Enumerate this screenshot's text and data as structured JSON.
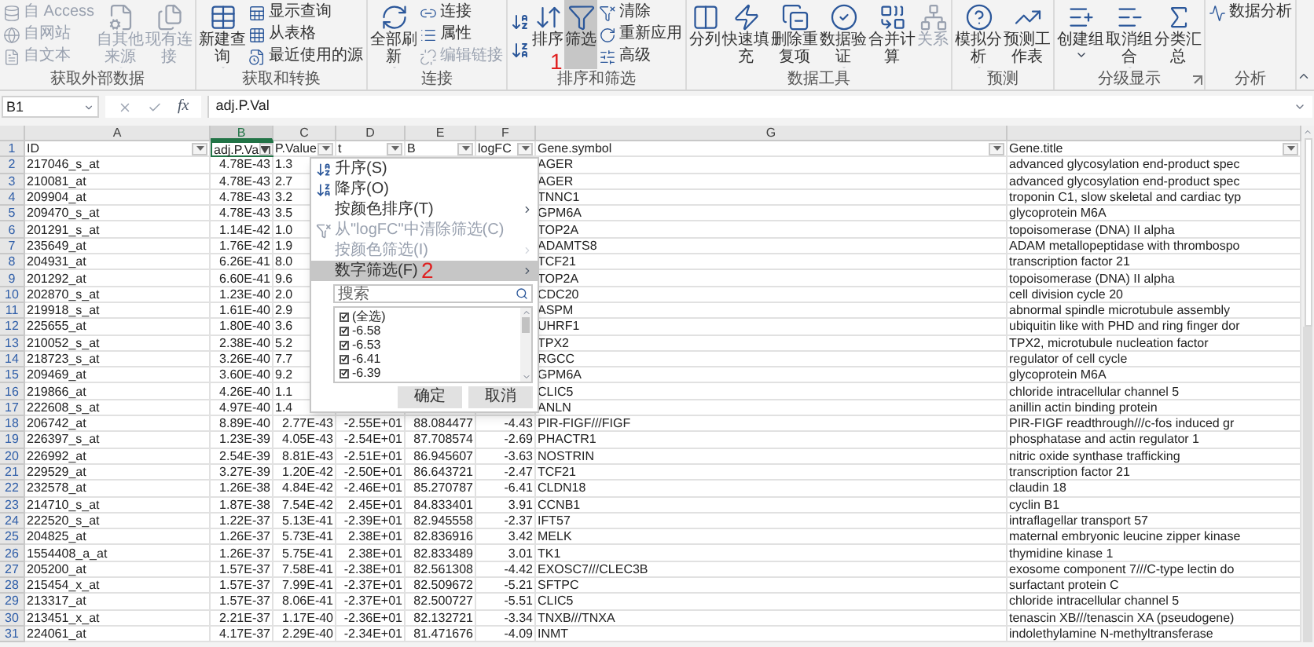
{
  "ribbon": {
    "groups": [
      {
        "label": "获取外部数据",
        "items": [
          {
            "kind": "stack",
            "buttons": [
              {
                "label": "自 Access",
                "disabled": true
              },
              {
                "label": "自网站",
                "disabled": true
              },
              {
                "label": "自文本",
                "disabled": true
              }
            ]
          },
          {
            "kind": "large",
            "label": "自其他来源",
            "disabled": true,
            "dropdown": true
          },
          {
            "kind": "large",
            "label": "现有连接",
            "disabled": true,
            "dropdown": false
          }
        ]
      },
      {
        "label": "获取和转换",
        "items": [
          {
            "kind": "large",
            "label": "新建查询",
            "disabled": false,
            "dropdown": true
          },
          {
            "kind": "stack",
            "buttons": [
              {
                "label": "显示查询",
                "disabled": false
              },
              {
                "label": "从表格",
                "disabled": false
              },
              {
                "label": "最近使用的源",
                "disabled": false
              }
            ]
          }
        ]
      },
      {
        "label": "连接",
        "items": [
          {
            "kind": "large",
            "label": "全部刷新",
            "disabled": false,
            "dropdown": true
          },
          {
            "kind": "stack",
            "buttons": [
              {
                "label": "连接",
                "disabled": false
              },
              {
                "label": "属性",
                "disabled": false
              },
              {
                "label": "编辑链接",
                "disabled": true
              }
            ]
          }
        ]
      },
      {
        "label": "排序和筛选",
        "items": [
          {
            "kind": "iconstack"
          },
          {
            "kind": "large",
            "label": "排序",
            "disabled": false,
            "dropdown": false,
            "pressed": false,
            "badge": "1"
          },
          {
            "kind": "large",
            "label": "筛选",
            "disabled": false,
            "dropdown": false,
            "pressed": true
          },
          {
            "kind": "stack",
            "buttons": [
              {
                "label": "清除",
                "disabled": false
              },
              {
                "label": "重新应用",
                "disabled": false
              },
              {
                "label": "高级",
                "disabled": false
              }
            ]
          }
        ]
      },
      {
        "label": "数据工具",
        "items": [
          {
            "kind": "large",
            "label": "分列",
            "disabled": false,
            "dropdown": false
          },
          {
            "kind": "large",
            "label": "快速填充",
            "disabled": false,
            "dropdown": false
          },
          {
            "kind": "large",
            "label": "删除重复项",
            "disabled": false,
            "dropdown": false
          },
          {
            "kind": "large",
            "label": "数据验证",
            "disabled": false,
            "dropdown": true
          },
          {
            "kind": "large",
            "label": "合并计算",
            "disabled": false,
            "dropdown": false
          },
          {
            "kind": "large",
            "label": "关系",
            "disabled": true,
            "dropdown": false
          }
        ]
      },
      {
        "label": "预测",
        "items": [
          {
            "kind": "large",
            "label": "模拟分析",
            "disabled": false,
            "dropdown": true
          },
          {
            "kind": "large",
            "label": "预测工作表",
            "disabled": false,
            "dropdown": false
          }
        ]
      },
      {
        "label": "分级显示",
        "dialog_launcher": true,
        "items": [
          {
            "kind": "large",
            "label": "创建组",
            "disabled": false,
            "dropdown": true
          },
          {
            "kind": "large",
            "label": "取消组合",
            "disabled": false,
            "dropdown": true
          },
          {
            "kind": "large",
            "label": "分类汇总",
            "disabled": false,
            "dropdown": false
          }
        ]
      },
      {
        "label": "分析",
        "items": [
          {
            "kind": "stack",
            "buttons": [
              {
                "label": "数据分析",
                "disabled": false
              }
            ]
          }
        ]
      }
    ]
  },
  "formula_bar": {
    "name_box": "B1",
    "function_label": "fx",
    "formula": "adj.P.Val"
  },
  "columns": [
    {
      "letter": "A",
      "selected": false
    },
    {
      "letter": "B",
      "selected": true
    },
    {
      "letter": "C",
      "selected": false
    },
    {
      "letter": "D",
      "selected": false
    },
    {
      "letter": "E",
      "selected": false
    },
    {
      "letter": "F",
      "selected": false
    },
    {
      "letter": "G",
      "selected": false
    }
  ],
  "header_row": {
    "number": "1",
    "cells": [
      {
        "text": "ID",
        "sorted": false
      },
      {
        "text": "adj.P.Va",
        "sorted": true
      },
      {
        "text": "P.Value",
        "sorted": false
      },
      {
        "text": "t",
        "sorted": false
      },
      {
        "text": "B",
        "sorted": false
      },
      {
        "text": "logFC",
        "sorted": false
      },
      {
        "text": "Gene.symbol",
        "sorted": false
      },
      {
        "text": "Gene.title",
        "sorted": false
      }
    ]
  },
  "rows": [
    {
      "n": "2",
      "id": "217046_s_at",
      "adj_p_val": "4.78E-43",
      "p_value": "1.3",
      "gene_symbol": "AGER",
      "gene_title": "advanced glycosylation end-product spec"
    },
    {
      "n": "3",
      "id": "210081_at",
      "adj_p_val": "4.78E-43",
      "p_value": "2.7",
      "gene_symbol": "AGER",
      "gene_title": "advanced glycosylation end-product spec"
    },
    {
      "n": "4",
      "id": "209904_at",
      "adj_p_val": "4.78E-43",
      "p_value": "3.2",
      "gene_symbol": "TNNC1",
      "gene_title": "troponin C1, slow skeletal and cardiac typ"
    },
    {
      "n": "5",
      "id": "209470_s_at",
      "adj_p_val": "4.78E-43",
      "p_value": "3.5",
      "gene_symbol": "GPM6A",
      "gene_title": "glycoprotein M6A"
    },
    {
      "n": "6",
      "id": "201291_s_at",
      "adj_p_val": "1.14E-42",
      "p_value": "1.0",
      "gene_symbol": "TOP2A",
      "gene_title": "topoisomerase (DNA) II alpha"
    },
    {
      "n": "7",
      "id": "235649_at",
      "adj_p_val": "1.76E-42",
      "p_value": "1.9",
      "gene_symbol": "ADAMTS8",
      "gene_title": "ADAM metallopeptidase with thrombospo"
    },
    {
      "n": "8",
      "id": "204931_at",
      "adj_p_val": "6.26E-41",
      "p_value": "8.0",
      "gene_symbol": "TCF21",
      "gene_title": "transcription factor 21"
    },
    {
      "n": "9",
      "id": "201292_at",
      "adj_p_val": "6.60E-41",
      "p_value": "9.6",
      "gene_symbol": "TOP2A",
      "gene_title": "topoisomerase (DNA) II alpha"
    },
    {
      "n": "10",
      "id": "202870_s_at",
      "adj_p_val": "1.23E-40",
      "p_value": "2.0",
      "gene_symbol": "CDC20",
      "gene_title": "cell division cycle 20"
    },
    {
      "n": "11",
      "id": "219918_s_at",
      "adj_p_val": "1.61E-40",
      "p_value": "2.9",
      "gene_symbol": "ASPM",
      "gene_title": "abnormal spindle microtubule assembly"
    },
    {
      "n": "12",
      "id": "225655_at",
      "adj_p_val": "1.80E-40",
      "p_value": "3.6",
      "gene_symbol": "UHRF1",
      "gene_title": "ubiquitin like with PHD and ring finger dor"
    },
    {
      "n": "13",
      "id": "210052_s_at",
      "adj_p_val": "2.38E-40",
      "p_value": "5.2",
      "gene_symbol": "TPX2",
      "gene_title": "TPX2, microtubule nucleation factor"
    },
    {
      "n": "14",
      "id": "218723_s_at",
      "adj_p_val": "3.26E-40",
      "p_value": "7.7",
      "gene_symbol": "RGCC",
      "gene_title": "regulator of cell cycle"
    },
    {
      "n": "15",
      "id": "209469_at",
      "adj_p_val": "3.60E-40",
      "p_value": "9.2",
      "gene_symbol": "GPM6A",
      "gene_title": "glycoprotein M6A"
    },
    {
      "n": "16",
      "id": "219866_at",
      "adj_p_val": "4.26E-40",
      "p_value": "1.1",
      "gene_symbol": "CLIC5",
      "gene_title": "chloride intracellular channel 5"
    },
    {
      "n": "17",
      "id": "222608_s_at",
      "adj_p_val": "4.97E-40",
      "p_value": "1.4",
      "gene_symbol": "ANLN",
      "gene_title": "anillin actin binding protein"
    },
    {
      "n": "18",
      "id": "206742_at",
      "adj_p_val": "8.89E-40",
      "p_value": "2.77E-43",
      "t": "-2.55E+01",
      "b": "88.084477",
      "logfc": "-4.43",
      "gene_symbol": "PIR-FIGF///FIGF",
      "gene_title": "PIR-FIGF readthrough///c-fos induced gr"
    },
    {
      "n": "19",
      "id": "226397_s_at",
      "adj_p_val": "1.23E-39",
      "p_value": "4.05E-43",
      "t": "-2.54E+01",
      "b": "87.708574",
      "logfc": "-2.69",
      "gene_symbol": "PHACTR1",
      "gene_title": "phosphatase and actin regulator 1"
    },
    {
      "n": "20",
      "id": "226992_at",
      "adj_p_val": "2.54E-39",
      "p_value": "8.81E-43",
      "t": "-2.51E+01",
      "b": "86.945607",
      "logfc": "-3.63",
      "gene_symbol": "NOSTRIN",
      "gene_title": "nitric oxide synthase trafficking"
    },
    {
      "n": "21",
      "id": "229529_at",
      "adj_p_val": "3.27E-39",
      "p_value": "1.20E-42",
      "t": "-2.50E+01",
      "b": "86.643721",
      "logfc": "-2.47",
      "gene_symbol": "TCF21",
      "gene_title": "transcription factor 21"
    },
    {
      "n": "22",
      "id": "232578_at",
      "adj_p_val": "1.26E-38",
      "p_value": "4.84E-42",
      "t": "-2.46E+01",
      "b": "85.270787",
      "logfc": "-6.41",
      "gene_symbol": "CLDN18",
      "gene_title": "claudin 18"
    },
    {
      "n": "23",
      "id": "214710_s_at",
      "adj_p_val": "1.87E-38",
      "p_value": "7.54E-42",
      "t": "2.45E+01",
      "b": "84.833401",
      "logfc": "3.91",
      "gene_symbol": "CCNB1",
      "gene_title": "cyclin B1"
    },
    {
      "n": "24",
      "id": "222520_s_at",
      "adj_p_val": "1.22E-37",
      "p_value": "5.13E-41",
      "t": "-2.39E+01",
      "b": "82.945558",
      "logfc": "-2.37",
      "gene_symbol": "IFT57",
      "gene_title": "intraflagellar transport 57"
    },
    {
      "n": "25",
      "id": "204825_at",
      "adj_p_val": "1.26E-37",
      "p_value": "5.73E-41",
      "t": "2.38E+01",
      "b": "82.836916",
      "logfc": "3.42",
      "gene_symbol": "MELK",
      "gene_title": "maternal embryonic leucine zipper kinase"
    },
    {
      "n": "26",
      "id": "1554408_a_at",
      "adj_p_val": "1.26E-37",
      "p_value": "5.75E-41",
      "t": "2.38E+01",
      "b": "82.833489",
      "logfc": "3.01",
      "gene_symbol": "TK1",
      "gene_title": "thymidine kinase 1"
    },
    {
      "n": "27",
      "id": "205200_at",
      "adj_p_val": "1.57E-37",
      "p_value": "7.58E-41",
      "t": "-2.38E+01",
      "b": "82.561308",
      "logfc": "-4.42",
      "gene_symbol": "EXOSC7///CLEC3B",
      "gene_title": "exosome component 7///C-type lectin do"
    },
    {
      "n": "28",
      "id": "215454_x_at",
      "adj_p_val": "1.57E-37",
      "p_value": "7.99E-41",
      "t": "-2.37E+01",
      "b": "82.509672",
      "logfc": "-5.21",
      "gene_symbol": "SFTPC",
      "gene_title": "surfactant protein C"
    },
    {
      "n": "29",
      "id": "213317_at",
      "adj_p_val": "1.57E-37",
      "p_value": "8.06E-41",
      "t": "-2.37E+01",
      "b": "82.500727",
      "logfc": "-5.51",
      "gene_symbol": "CLIC5",
      "gene_title": "chloride intracellular channel 5"
    },
    {
      "n": "30",
      "id": "213451_x_at",
      "adj_p_val": "2.21E-37",
      "p_value": "1.17E-40",
      "t": "-2.36E+01",
      "b": "82.132721",
      "logfc": "-3.34",
      "gene_symbol": "TNXB///TNXA",
      "gene_title": "tenascin XB///tenascin XA (pseudogene)"
    },
    {
      "n": "31",
      "id": "224061_at",
      "adj_p_val": "4.17E-37",
      "p_value": "2.29E-40",
      "t": "-2.34E+01",
      "b": "81.471676",
      "logfc": "-4.09",
      "gene_symbol": "INMT",
      "gene_title": "indolethylamine N-methyltransferase"
    }
  ],
  "filter_menu": {
    "items": [
      {
        "kind": "sort_asc",
        "label": "升序(S)",
        "disabled": false,
        "selected": false,
        "submenu": false
      },
      {
        "kind": "sort_desc",
        "label": "降序(O)",
        "disabled": false,
        "selected": false,
        "submenu": false
      },
      {
        "kind": "plain",
        "label": "按颜色排序(T)",
        "disabled": false,
        "selected": false,
        "submenu": true
      },
      {
        "kind": "clear",
        "label": "从\"logFC\"中清除筛选(C)",
        "disabled": true,
        "selected": false,
        "submenu": false
      },
      {
        "kind": "plain",
        "label": "按颜色筛选(I)",
        "disabled": true,
        "selected": false,
        "submenu": true
      },
      {
        "kind": "plain",
        "label": "数字筛选(F)",
        "disabled": false,
        "selected": true,
        "submenu": true,
        "badge": "2"
      }
    ],
    "search": {
      "placeholder": "搜索"
    },
    "values": [
      {
        "label": "(全选)",
        "checked": true
      },
      {
        "label": "-6.58",
        "checked": true
      },
      {
        "label": "-6.53",
        "checked": true
      },
      {
        "label": "-6.41",
        "checked": true
      },
      {
        "label": "-6.39",
        "checked": true
      }
    ],
    "buttons": [
      "确定",
      "取消"
    ]
  }
}
